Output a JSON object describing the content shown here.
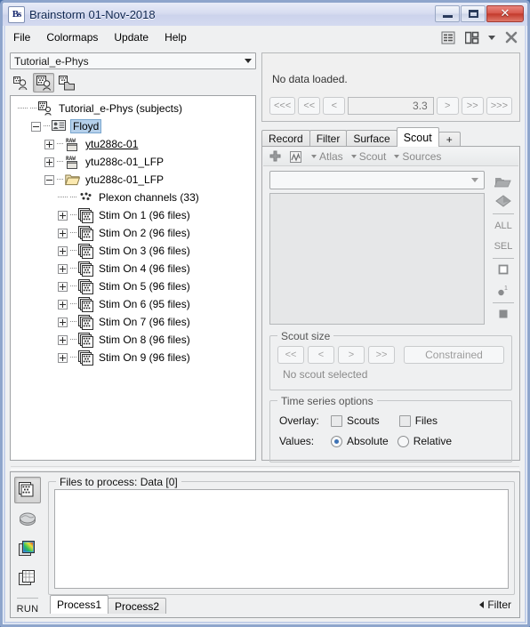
{
  "window": {
    "title": "Brainstorm 01-Nov-2018",
    "app_icon": "Bs",
    "buttons": {
      "minimize": "minimize-icon",
      "maximize": "maximize-icon",
      "close": "✕"
    }
  },
  "menubar": {
    "items": [
      {
        "label": "File"
      },
      {
        "label": "Colormaps"
      },
      {
        "label": "Update"
      },
      {
        "label": "Help"
      }
    ],
    "right_icons": [
      "list-icon",
      "layout-icon",
      "chevron-down-icon",
      "close-icon"
    ]
  },
  "left_panel": {
    "protocol_combo": {
      "value": "Tutorial_e-Phys"
    },
    "toolbar": [
      {
        "name": "subjects-view-button",
        "selected": false
      },
      {
        "name": "functional-data-view-button",
        "selected": true
      },
      {
        "name": "functional-data-sources-view-button",
        "selected": false
      }
    ],
    "tree": [
      {
        "label": "Tutorial_e-Phys (subjects)",
        "indent": 0,
        "expander": "none",
        "icon": "protocol-icon",
        "selected": false,
        "link": false
      },
      {
        "label": "Floyd",
        "indent": 1,
        "expander": "minus",
        "icon": "subject-icon",
        "selected": true,
        "link": false
      },
      {
        "label": "ytu288c-01",
        "indent": 2,
        "expander": "plus",
        "icon": "raw-folder-icon",
        "selected": false,
        "link": true
      },
      {
        "label": "ytu288c-01_LFP",
        "indent": 2,
        "expander": "plus",
        "icon": "raw-folder-icon",
        "selected": false,
        "link": false
      },
      {
        "label": "ytu288c-01_LFP",
        "indent": 2,
        "expander": "minus",
        "icon": "folder-icon",
        "selected": false,
        "link": false
      },
      {
        "label": "Plexon channels (33)",
        "indent": 3,
        "expander": "none",
        "icon": "channel-icon",
        "selected": false,
        "link": false
      },
      {
        "label": "Stim On 1 (96 files)",
        "indent": 3,
        "expander": "plus",
        "icon": "data-stack-icon",
        "selected": false,
        "link": false
      },
      {
        "label": "Stim On 2 (96 files)",
        "indent": 3,
        "expander": "plus",
        "icon": "data-stack-icon",
        "selected": false,
        "link": false
      },
      {
        "label": "Stim On 3 (96 files)",
        "indent": 3,
        "expander": "plus",
        "icon": "data-stack-icon",
        "selected": false,
        "link": false
      },
      {
        "label": "Stim On 4 (96 files)",
        "indent": 3,
        "expander": "plus",
        "icon": "data-stack-icon",
        "selected": false,
        "link": false
      },
      {
        "label": "Stim On 5 (96 files)",
        "indent": 3,
        "expander": "plus",
        "icon": "data-stack-icon",
        "selected": false,
        "link": false
      },
      {
        "label": "Stim On 6 (95 files)",
        "indent": 3,
        "expander": "plus",
        "icon": "data-stack-icon",
        "selected": false,
        "link": false
      },
      {
        "label": "Stim On 7 (96 files)",
        "indent": 3,
        "expander": "plus",
        "icon": "data-stack-icon",
        "selected": false,
        "link": false
      },
      {
        "label": "Stim On 8 (96 files)",
        "indent": 3,
        "expander": "plus",
        "icon": "data-stack-icon",
        "selected": false,
        "link": false
      },
      {
        "label": "Stim On 9 (96 files)",
        "indent": 3,
        "expander": "plus",
        "icon": "data-stack-icon",
        "selected": false,
        "link": false
      }
    ]
  },
  "right_panel": {
    "status": "No data loaded.",
    "nav": {
      "first_label": "<<<",
      "prev_page_label": "<<",
      "prev_label": "<",
      "value": "3.3",
      "next_label": ">",
      "next_page_label": ">>",
      "last_label": ">>>"
    },
    "tabs": [
      {
        "label": "Record",
        "active": false
      },
      {
        "label": "Filter",
        "active": false
      },
      {
        "label": "Surface",
        "active": false
      },
      {
        "label": "Scout",
        "active": true
      },
      {
        "label": "+",
        "active": false
      }
    ],
    "scout": {
      "toolbar": {
        "add_label": "add-scout-icon",
        "display_label": "scout-display-icon",
        "menus": [
          {
            "label": "Atlas"
          },
          {
            "label": "Scout"
          },
          {
            "label": "Sources"
          }
        ]
      },
      "atlas_combo": {
        "value": ""
      },
      "list_items": [],
      "side_buttons": [
        {
          "name": "load-scout-button",
          "label": ""
        },
        {
          "name": "save-scout-button",
          "label": ""
        },
        {
          "name": "select-all-button",
          "label": "ALL"
        },
        {
          "name": "select-sel-button",
          "label": "SEL"
        },
        {
          "name": "scout-outline-button",
          "label": ""
        },
        {
          "name": "scout-seed-button",
          "label": ""
        },
        {
          "name": "scout-fill-button",
          "label": ""
        }
      ],
      "size_group": {
        "title": "Scout size",
        "buttons": [
          "<<",
          "<",
          ">",
          ">>"
        ],
        "constrained_label": "Constrained",
        "status": "No scout selected"
      },
      "timeseries_group": {
        "title": "Time series options",
        "overlay_label": "Overlay:",
        "overlay_options": [
          {
            "label": "Scouts",
            "checked": false
          },
          {
            "label": "Files",
            "checked": false
          }
        ],
        "values_label": "Values:",
        "values_options": [
          {
            "label": "Absolute",
            "selected": true
          },
          {
            "label": "Relative",
            "selected": false
          }
        ]
      }
    }
  },
  "bottom_panel": {
    "toolbar": [
      {
        "name": "process-recordings-button",
        "selected": true
      },
      {
        "name": "process-sources-button",
        "selected": false
      },
      {
        "name": "process-timefreq-button",
        "selected": false
      },
      {
        "name": "process-matrix-button",
        "selected": false
      }
    ],
    "run_label": "RUN",
    "files_group_title": "Files to process: Data [0]",
    "tabs": [
      {
        "label": "Process1",
        "active": true
      },
      {
        "label": "Process2",
        "active": false
      }
    ],
    "filter_label": "Filter"
  },
  "colors": {
    "titlebar": "#d7dcf0",
    "frame": "#8ea5cc",
    "panel": "#eff0f1",
    "selection": "#b5d0ea",
    "accent": "#3d72b5",
    "close_button": "#c33a2c"
  }
}
